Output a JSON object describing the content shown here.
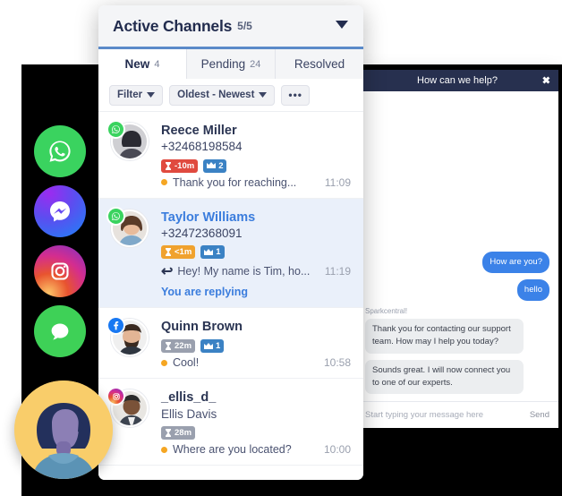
{
  "rail": {
    "icons": [
      {
        "name": "whatsapp-icon",
        "label": "WhatsApp"
      },
      {
        "name": "messenger-icon",
        "label": "Facebook Messenger"
      },
      {
        "name": "instagram-icon",
        "label": "Instagram"
      },
      {
        "name": "sms-icon",
        "label": "SMS"
      }
    ]
  },
  "panel": {
    "title": "Active Channels",
    "count": "5/5",
    "tabs": [
      {
        "label": "New",
        "badge": "4",
        "active": true
      },
      {
        "label": "Pending",
        "badge": "24",
        "active": false
      },
      {
        "label": "Resolved",
        "badge": "",
        "active": false
      }
    ],
    "filter": {
      "filter_label": "Filter",
      "sort_label": "Oldest - Newest",
      "more_label": "•••"
    },
    "conversations": [
      {
        "name": "Reece Miller",
        "subtitle": "+32468198584",
        "channel": "whatsapp",
        "badges": [
          {
            "kind": "sla",
            "color": "red",
            "text": "-10m",
            "icon": "hourglass-icon"
          },
          {
            "kind": "priority",
            "color": "blue",
            "text": "2",
            "icon": "crown-icon"
          }
        ],
        "snippet": "Thank you for reaching...",
        "time": "11:09",
        "status": "",
        "selected": false,
        "inbound": true
      },
      {
        "name": "Taylor Williams",
        "subtitle": "+32472368091",
        "channel": "whatsapp",
        "badges": [
          {
            "kind": "sla",
            "color": "orange",
            "text": "<1m",
            "icon": "hourglass-icon"
          },
          {
            "kind": "priority",
            "color": "blue",
            "text": "1",
            "icon": "crown-icon"
          }
        ],
        "snippet": "Hey! My name is Tim, ho...",
        "time": "11:19",
        "status": "You are replying",
        "selected": true,
        "inbound": false
      },
      {
        "name": "Quinn Brown",
        "subtitle": "",
        "channel": "facebook",
        "badges": [
          {
            "kind": "sla",
            "color": "gray",
            "text": "22m",
            "icon": "hourglass-icon"
          },
          {
            "kind": "priority",
            "color": "blue",
            "text": "1",
            "icon": "crown-icon"
          }
        ],
        "snippet": "Cool!",
        "time": "10:58",
        "status": "",
        "selected": false,
        "inbound": true
      },
      {
        "name": "_ellis_d_",
        "subtitle": "Ellis Davis",
        "channel": "instagram",
        "badges": [
          {
            "kind": "sla",
            "color": "gray",
            "text": "28m",
            "icon": "hourglass-icon"
          }
        ],
        "snippet": "Where are you located?",
        "time": "10:00",
        "status": "",
        "selected": false,
        "inbound": true
      }
    ]
  },
  "chat": {
    "header_title": "How can we help?",
    "close_label": "✖",
    "agent_name": "Sparkcentral!",
    "messages": [
      {
        "from": "visitor",
        "text": "How are you?"
      },
      {
        "from": "visitor",
        "text": "hello"
      },
      {
        "from": "agent",
        "text": "Thank you for contacting our support team. How may I help you today?"
      },
      {
        "from": "agent",
        "text": "Sounds great. I will now connect you to one of our experts."
      }
    ],
    "input_placeholder": "Start typing your message here",
    "send_label": "Send"
  },
  "colors": {
    "accent_blue": "#3b7ddd",
    "header_bg": "#f4f5f7",
    "navy": "#27304f",
    "sla_red": "#e04a3f",
    "sla_orange": "#f0a22e",
    "sla_gray": "#9aa0ae",
    "priority_blue": "#3b82c4",
    "whatsapp_green": "#3ad35f",
    "avatar_yellow": "#f9cd6a"
  }
}
